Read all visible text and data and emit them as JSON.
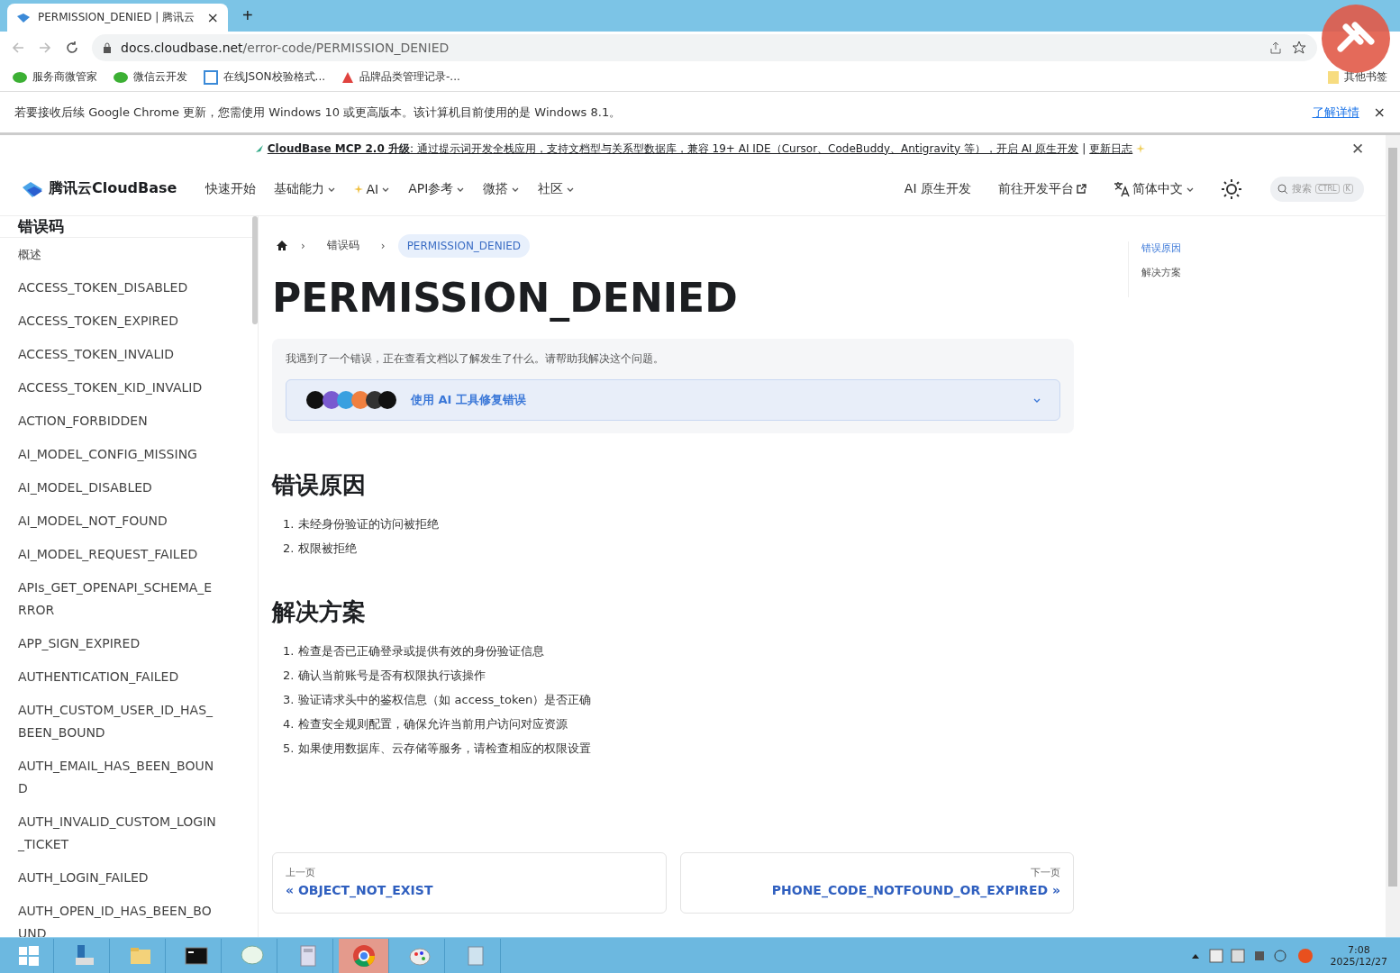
{
  "browser": {
    "tab": {
      "title": "PERMISSION_DENIED | 腾讯云",
      "close": "×"
    },
    "new_tab": "+",
    "url": {
      "host": "docs.cloudbase.net",
      "path": "/error-code/PERMISSION_DENIED"
    },
    "bookmarks": [
      {
        "label": "服务商微管家",
        "kind": "wechat"
      },
      {
        "label": "微信云开发",
        "kind": "wechat"
      },
      {
        "label": "在线JSON校验格式...",
        "kind": "bracket"
      },
      {
        "label": "品牌品类管理记录-...",
        "kind": "triangle"
      }
    ],
    "other_bookmarks": "其他书签",
    "infobar": {
      "text": "若要接收后续 Google Chrome 更新，您需使用 Windows 10 或更高版本。该计算机目前使用的是 Windows 8.1。",
      "link": "了解详情",
      "close": "×"
    }
  },
  "announcement": {
    "text": "**CloudBase MCP 2.0 升级**: 通过提示词开发全栈应用，支持文档型与关系型数据库，兼容 19+ AI IDE（Cursor、CodeBuddy、Antigravity 等），开启 AI 原生开发",
    "separator": "|",
    "link": "更新日志",
    "close": "✕"
  },
  "site_nav": {
    "logo": "腾讯云CloudBase",
    "items": [
      {
        "label": "快速开始",
        "dropdown": false
      },
      {
        "label": "基础能力",
        "dropdown": true
      },
      {
        "label": "AI",
        "dropdown": true,
        "sparkle": true
      },
      {
        "label": "API参考",
        "dropdown": true
      },
      {
        "label": "微搭",
        "dropdown": true
      },
      {
        "label": "社区",
        "dropdown": true
      }
    ],
    "right": [
      {
        "label": "AI 原生开发",
        "kind": "plain"
      },
      {
        "label": "前往开发平台",
        "kind": "external"
      },
      {
        "label": "简体中文",
        "kind": "language"
      }
    ],
    "search": {
      "placeholder": "搜索",
      "keys": [
        "CTRL",
        "K"
      ]
    }
  },
  "sidebar": {
    "title": "错误码",
    "items": [
      {
        "label": "概述",
        "kind": "zh"
      },
      {
        "label": "ACCESS_TOKEN_DISABLED"
      },
      {
        "label": "ACCESS_TOKEN_EXPIRED"
      },
      {
        "label": "ACCESS_TOKEN_INVALID"
      },
      {
        "label": "ACCESS_TOKEN_KID_INVALID"
      },
      {
        "label": "ACTION_FORBIDDEN"
      },
      {
        "label": "AI_MODEL_CONFIG_MISSING"
      },
      {
        "label": "AI_MODEL_DISABLED"
      },
      {
        "label": "AI_MODEL_NOT_FOUND"
      },
      {
        "label": "AI_MODEL_REQUEST_FAILED"
      },
      {
        "label": "APIs_GET_OPENAPI_SCHEMA_ERROR"
      },
      {
        "label": "APP_SIGN_EXPIRED"
      },
      {
        "label": "AUTHENTICATION_FAILED"
      },
      {
        "label": "AUTH_CUSTOM_USER_ID_HAS_BEEN_BOUND"
      },
      {
        "label": "AUTH_EMAIL_HAS_BEEN_BOUND"
      },
      {
        "label": "AUTH_INVALID_CUSTOM_LOGIN_TICKET"
      },
      {
        "label": "AUTH_LOGIN_FAILED"
      },
      {
        "label": "AUTH_OPEN_ID_HAS_BEEN_BOUND"
      }
    ]
  },
  "breadcrumb_separator": "›",
  "breadcrumbs": [
    {
      "label": "错误码",
      "current": false
    },
    {
      "label": "PERMISSION_DENIED",
      "current": true
    }
  ],
  "title": "PERMISSION_DENIED",
  "ai_box": {
    "prompt": "我遇到了一个错误，正在查看文档以了解发生了什么。请帮助我解决这个问题。",
    "button": "使用 AI 工具修复错误",
    "expanded": false
  },
  "sections": [
    {
      "heading": "错误原因",
      "items": [
        {
          "number": "1.",
          "text": "未经身份验证的访问被拒绝"
        },
        {
          "number": "2.",
          "text": "权限被拒绝"
        }
      ]
    },
    {
      "heading": "解决方案",
      "items": [
        {
          "number": "1.",
          "text": "检查是否已正确登录或提供有效的身份验证信息"
        },
        {
          "number": "2.",
          "text": "确认当前账号是否有权限执行该操作"
        },
        {
          "number": "3.",
          "text": "验证请求头中的鉴权信息（如 access_token）是否正确"
        },
        {
          "number": "4.",
          "text": "检查安全规则配置，确保允许当前用户访问对应资源"
        },
        {
          "number": "5.",
          "text": "如果使用数据库、云存储等服务，请检查相应的权限设置"
        }
      ]
    }
  ],
  "pager": {
    "prev": {
      "caption": "上一页",
      "label": "« OBJECT_NOT_EXIST"
    },
    "next": {
      "caption": "下一页",
      "label": "PHONE_CODE_NOTFOUND_OR_EXPIRED »"
    }
  },
  "toc": [
    {
      "label": "错误原因",
      "selected": true
    },
    {
      "label": "解决方案",
      "selected": false
    }
  ],
  "taskbar": {
    "apps": [
      {
        "kind": "start"
      },
      {
        "kind": "server"
      },
      {
        "kind": "folder"
      },
      {
        "kind": "terminal"
      },
      {
        "kind": "chat"
      },
      {
        "kind": "calculator"
      },
      {
        "kind": "chrome",
        "selected": true
      },
      {
        "kind": "paint"
      },
      {
        "kind": "notepad"
      }
    ],
    "time": "7:08",
    "date": "2025/12/27"
  }
}
